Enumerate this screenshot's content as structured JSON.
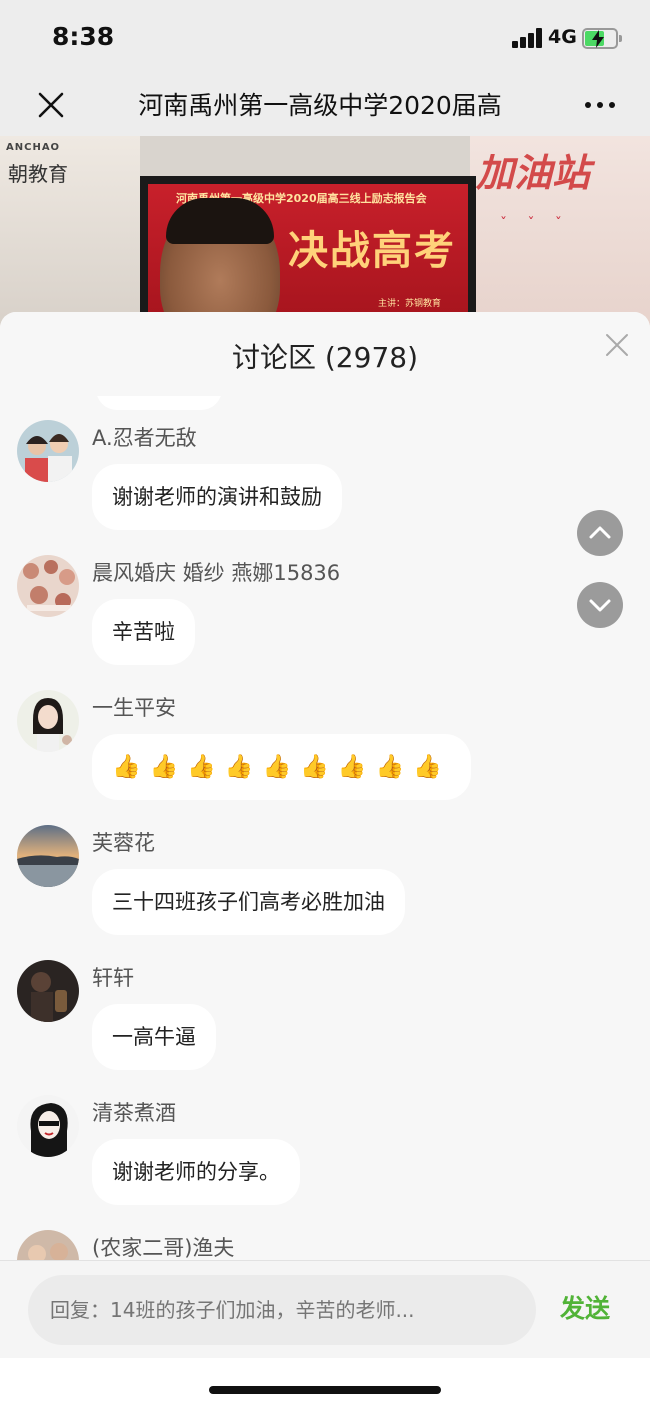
{
  "status_bar": {
    "time": "8:38",
    "network": "4G"
  },
  "nav": {
    "title": "河南禹州第一高级中学2020届高"
  },
  "video": {
    "logo_text": "ANCHAO",
    "logo_chinese": "朝教育",
    "right_banner": "加油站",
    "screen_title": "河南禹州第一高级中学2020届高三线上励志报告会",
    "screen_big": "决战高考",
    "screen_sub": "主讲：苏钢教育"
  },
  "panel": {
    "title": "讨论区 (2978)"
  },
  "messages": [
    {
      "sender": "A.忍者无敌",
      "text": "谢谢老师的演讲和鼓励"
    },
    {
      "sender": "晨风婚庆 婚纱 燕娜15836",
      "text": "辛苦啦"
    },
    {
      "sender": "一生平安",
      "text": "👍👍👍👍👍👍👍👍👍"
    },
    {
      "sender": "芙蓉花",
      "text": "三十四班孩子们高考必胜加油"
    },
    {
      "sender": "轩轩",
      "text": "一高牛逼"
    },
    {
      "sender": "清茶煮酒",
      "text": "谢谢老师的分享。"
    },
    {
      "sender": "(农家二哥)渔夫",
      "text": ""
    }
  ],
  "input": {
    "placeholder": "回复：14班的孩子们加油，辛苦的老师...",
    "send_label": "发送"
  },
  "colors": {
    "send_green": "#51b337",
    "panel_bg": "#f7f7f7",
    "bubble_bg": "#ffffff"
  }
}
